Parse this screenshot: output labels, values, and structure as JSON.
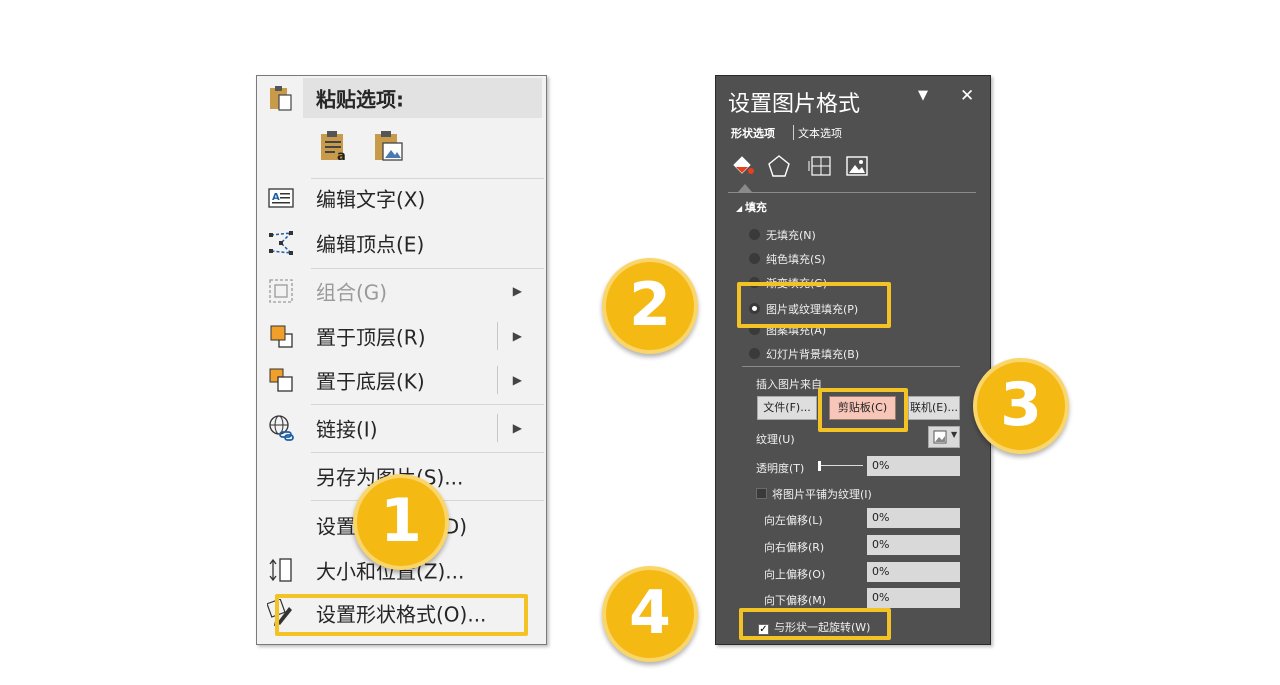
{
  "context_menu": {
    "paste_options_label": "粘贴选项:",
    "items": [
      {
        "label": "编辑文字(X)",
        "icon": "edit-text-icon"
      },
      {
        "label": "编辑顶点(E)",
        "icon": "edit-points-icon"
      },
      {
        "label": "组合(G)",
        "icon": "group-icon",
        "disabled": true,
        "submenu": true
      },
      {
        "label": "置于顶层(R)",
        "icon": "bring-to-front-icon",
        "submenu": true
      },
      {
        "label": "置于底层(K)",
        "icon": "send-to-back-icon",
        "submenu": true
      },
      {
        "label": "链接(I)",
        "icon": "link-icon",
        "submenu": true
      },
      {
        "label": "另存为图片(S)...",
        "icon": ""
      },
      {
        "label": "设置对象格式(D)",
        "icon": ""
      },
      {
        "label": "大小和位置(Z)...",
        "icon": "size-position-icon"
      },
      {
        "label": "设置形状格式(O)...",
        "icon": "format-shape-icon"
      }
    ]
  },
  "format_panel": {
    "title": "设置图片格式",
    "pin_symbol": "▼",
    "close_symbol": "✕",
    "tabs": [
      "形状选项",
      "文本选项"
    ],
    "section_title": "填充",
    "fill_options": [
      {
        "label": "无填充(N)",
        "selected": false
      },
      {
        "label": "纯色填充(S)",
        "selected": false
      },
      {
        "label": "渐变填充(G)",
        "selected": false
      },
      {
        "label": "图片或纹理填充(P)",
        "selected": true
      },
      {
        "label": "图案填充(A)",
        "selected": false
      },
      {
        "label": "幻灯片背景填充(B)",
        "selected": false
      }
    ],
    "insert_from_label": "插入图片来自",
    "buttons": {
      "file": "文件(F)...",
      "clipboard": "剪贴板(C)",
      "online": "联机(E)..."
    },
    "texture_label": "纹理(U)",
    "transparency_label": "透明度(T)",
    "transparency_value": "0%",
    "tile_label": "将图片平铺为纹理(I)",
    "offsets": [
      {
        "label": "向左偏移(L)",
        "value": "0%"
      },
      {
        "label": "向右偏移(R)",
        "value": "0%"
      },
      {
        "label": "向上偏移(O)",
        "value": "0%"
      },
      {
        "label": "向下偏移(M)",
        "value": "0%"
      }
    ],
    "rotate_label": "与形状一起旋转(W)",
    "rotate_checked": true
  },
  "badges": [
    "1",
    "2",
    "3",
    "4"
  ],
  "colors": {
    "highlight": "#f3c224",
    "badge": "#f5b914",
    "panel_bg": "#505050",
    "menu_bg": "#f2f2f2"
  }
}
